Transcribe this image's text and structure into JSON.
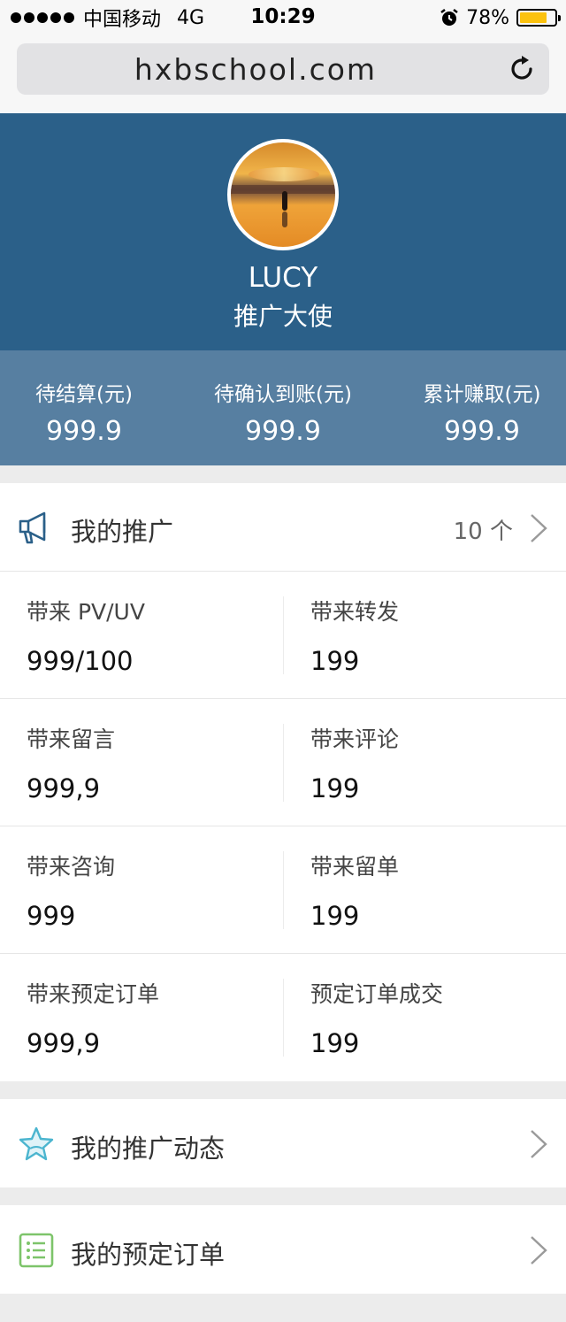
{
  "status_bar": {
    "carrier": "中国移动",
    "network": "4G",
    "time": "10:29",
    "battery_percent": "78%",
    "battery_level": 0.78,
    "colors": {
      "battery_fill": "#fbc20f"
    }
  },
  "browser": {
    "url": "hxbschool.com",
    "reload_icon": "reload-icon"
  },
  "profile": {
    "name": "LUCY",
    "role": "推广大使",
    "colors": {
      "header_bg": "#2b6089",
      "earnings_bg": "#577fa1"
    }
  },
  "earnings": [
    {
      "label": "待结算(元)",
      "value": "999.9"
    },
    {
      "label": "待确认到账(元)",
      "value": "999.9"
    },
    {
      "label": "累计赚取(元)",
      "value": "999.9"
    }
  ],
  "promotion": {
    "title": "我的推广",
    "count": "10 个",
    "icon": "megaphone-icon",
    "stats": [
      {
        "left": {
          "label": "带来 PV/UV",
          "value": "999/100"
        },
        "right": {
          "label": "带来转发",
          "value": "199"
        }
      },
      {
        "left": {
          "label": "带来留言",
          "value": "999,9"
        },
        "right": {
          "label": "带来评论",
          "value": "199"
        }
      },
      {
        "left": {
          "label": "带来咨询",
          "value": "999"
        },
        "right": {
          "label": "带来留单",
          "value": "199"
        }
      },
      {
        "left": {
          "label": "带来预定订单",
          "value": "999,9"
        },
        "right": {
          "label": "预定订单成交",
          "value": "199"
        }
      }
    ]
  },
  "menu": {
    "dynamics": {
      "title": "我的推广动态",
      "icon": "star-icon"
    },
    "orders": {
      "title": "我的预定订单",
      "icon": "list-icon"
    }
  }
}
